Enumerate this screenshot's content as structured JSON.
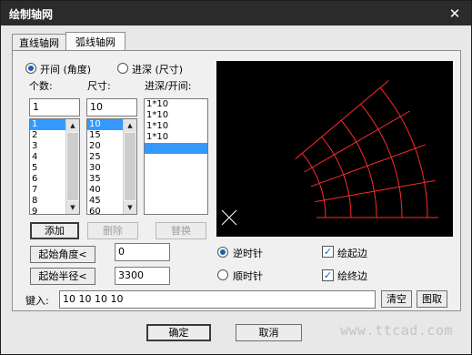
{
  "window": {
    "title": "绘制轴网",
    "close_symbol": "✕"
  },
  "tabs": [
    {
      "label": "直线轴网",
      "active": false
    },
    {
      "label": "弧线轴网",
      "active": true
    }
  ],
  "mode": {
    "open": {
      "label": "开间 (角度)",
      "selected": true
    },
    "depth": {
      "label": "进深 (尺寸)",
      "selected": false
    }
  },
  "count": {
    "label": "个数:",
    "value": "1",
    "options": [
      "1",
      "2",
      "3",
      "4",
      "5",
      "6",
      "7",
      "8",
      "9"
    ],
    "selected": "1"
  },
  "size": {
    "label": "尺寸:",
    "value": "10",
    "options": [
      "10",
      "15",
      "20",
      "25",
      "30",
      "35",
      "40",
      "45",
      "60"
    ],
    "selected": "10"
  },
  "entries": {
    "label": "进深/开间:",
    "items": [
      "1*10",
      "1*10",
      "1*10",
      "1*10"
    ]
  },
  "buttons": {
    "add": "添加",
    "delete": "删除",
    "replace": "替换",
    "start_angle": "起始角度<",
    "start_radius": "起始半径<",
    "clear": "清空",
    "pick": "图取",
    "ok": "确定",
    "cancel": "取消"
  },
  "start_angle_value": "0",
  "start_radius_value": "3300",
  "direction": {
    "ccw": {
      "label": "逆时针",
      "selected": true
    },
    "cw": {
      "label": "顺时针",
      "selected": false
    }
  },
  "edges": {
    "start_edge": {
      "label": "绘起边",
      "checked": true
    },
    "end_edge": {
      "label": "绘终边",
      "checked": true
    }
  },
  "input": {
    "label": "键入:",
    "value": "10 10 10 10"
  },
  "watermark": "www.ttcad.com",
  "preview": {
    "background": "#000000",
    "line_color": "#ff2a2a",
    "ucs_color": "#ffffff",
    "angles_deg": [
      0,
      10,
      20,
      30,
      40
    ],
    "arc_count": 5
  }
}
